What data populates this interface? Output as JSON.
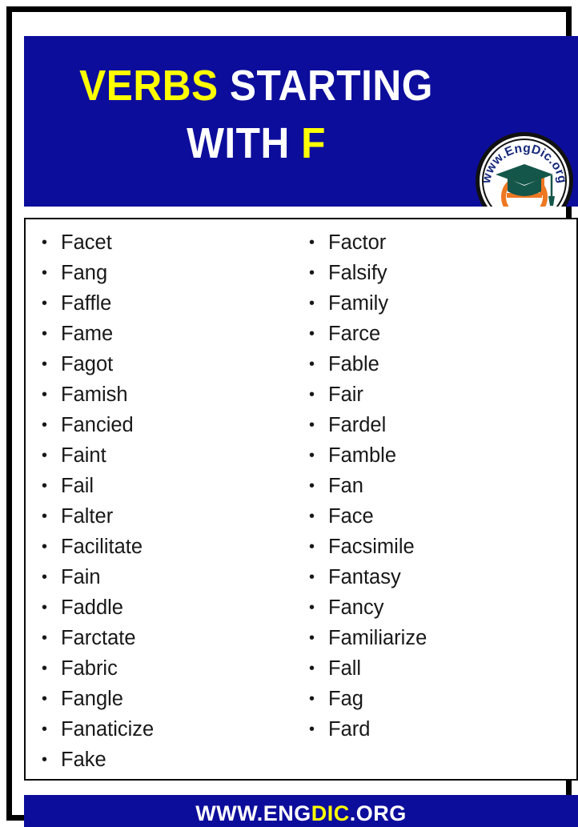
{
  "poster": {
    "header": {
      "background_color": "#0d0d9c",
      "title_line1_part1": "VERBS",
      "title_line1_part1_color": "#ffff00",
      "title_line1_part2": " STARTING",
      "title_line1_part2_color": "#ffffff",
      "title_line2_part1": "WITH ",
      "title_line2_part1_color": "#ffffff",
      "title_line2_part2": "F",
      "title_line2_part2_color": "#ffff00"
    },
    "logo": {
      "name": "engdic-logo",
      "curved_text": "www.EngDic.org",
      "letter": "e",
      "ring_color": "#111111",
      "text_color": "#14277a",
      "cap_color": "#14564a",
      "letter_color": "#ee7722",
      "background_color": "#ffffff"
    },
    "list": {
      "border_color": "#0a0a0a",
      "text_color": "#181818",
      "columns": [
        {
          "name": "left-column",
          "items": [
            "Facet",
            "Fang",
            "Faffle",
            "Fame",
            "Fagot",
            "Famish",
            "Fancied",
            "Faint",
            "Fail",
            "Falter",
            "Facilitate",
            "Fain",
            "Faddle",
            "Farctate",
            "Fabric",
            "Fangle",
            "Fanaticize",
            "Fake"
          ]
        },
        {
          "name": "right-column",
          "items": [
            "Factor",
            "Falsify",
            "Family",
            "Farce",
            "Fable",
            "Fair",
            "Fardel",
            "Famble",
            "Fan",
            "Face",
            "Facsimile",
            "Fantasy",
            "Fancy",
            "Familiarize",
            "Fall",
            "Fag",
            "Fard"
          ]
        }
      ]
    },
    "footer": {
      "background_color": "#0d0d9c",
      "part1": "WWW.ENG",
      "part1_color": "#ffffff",
      "part2": "DIC",
      "part2_color": "#ffff00",
      "part3": ".ORG",
      "part3_color": "#ffffff"
    }
  }
}
